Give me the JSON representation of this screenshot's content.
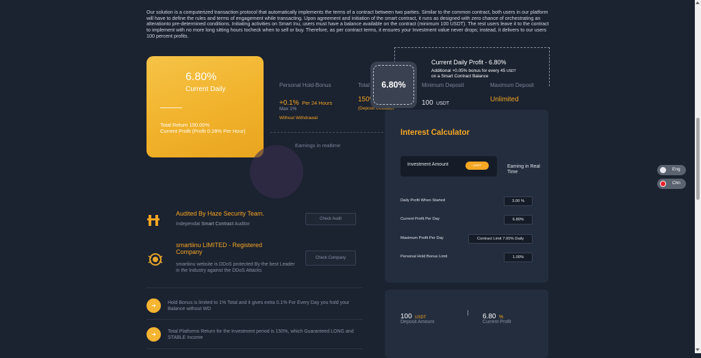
{
  "intro": "Our solution is a computerized transaction protocol that automatically implements the terms of a contract between two parties. Similar to the common contract, both users in our platform will have to define the rules and terms of engagement while transacting. Upon agreement and initiation of the smart contract, it runs as designed with zero chance of orchestrating an alterationto pre-determined conditions. Initiating activities on Smart Inu, users must have a balance available on the contract (minimum 100 USDT). The rest users leave it to the contract to implement with no more long sitting hours tocheck when to sell or buy. Therefore, as per contract terms, it ensures your Investment value never drops; instead, it delivers to our users 100 percent profits.",
  "gold_card": {
    "rate": "6.80%",
    "label": "Current Daily",
    "total_return": "Total Return 150.00%",
    "current_profit": "Current Profit (Profit 0.28% Per Hour)"
  },
  "stats": {
    "hold_label": "Personal Hold-Bonus",
    "hold_value": "+0.1%",
    "hold_unit": "Per 24 Hours",
    "hold_max": "Max 1%",
    "hold_note": "Without Withdrawal",
    "total_label": "Total",
    "total_value": "150%",
    "total_note": "(Deposit Included)",
    "min_label": "Minimum Deposit",
    "min_value": "100",
    "min_unit": "USDT",
    "max_label": "Maximum Deposit",
    "max_value": "Unlimited",
    "earnings": "Earnings in realtime"
  },
  "tooltip": {
    "badge": "6.80%",
    "title": "Current Daily Profit - 6.80%",
    "desc": "Additional +0.05% bonus for every 45",
    "desc_unit": "USDT",
    "desc2": "on a Smart Contract Balance"
  },
  "calculator": {
    "title": "Interest Calculator",
    "investment_label": "Investment Amount",
    "currency": "USDT",
    "earning_label": "Earning in Real Time",
    "rows": [
      {
        "label": "Daily Profit When Started",
        "value": "3.00 %"
      },
      {
        "label": "Current Profit Per Day",
        "value": "6.80%"
      },
      {
        "label": "Maximum Profit Per Day",
        "value": "Contract Limit 7.00% Daily"
      },
      {
        "label": "Personal Hold Bonus Limit",
        "value": "1.00%"
      }
    ]
  },
  "summary": {
    "deposit_value": "100",
    "deposit_unit": "USDT",
    "deposit_label": "Deposit Amount",
    "profit_value": "6.80",
    "profit_unit": "%",
    "profit_label": "Current Profit"
  },
  "audits": [
    {
      "title": "Audited By Haze Security Team.",
      "text_a": "Independat ",
      "text_b": "Smart Contract",
      "text_c": " Auditor",
      "button": "Check Audit"
    },
    {
      "title": "smartiinu LIMITED - Registered Company",
      "text": "smartiinu website is DDoS protected By the best Leader in the Industry against the DDoS Attacks",
      "button": "Check Company"
    }
  ],
  "notes": [
    "Hold Bonus is limited to 1% Total and it gives extra 0.1% For Every Day you hold your Balance without WD",
    "Total Platforms Return for the Investment period is 150%, which Guaranteed LONG and STABLE Income"
  ],
  "languages": [
    "Eng",
    "Chn"
  ],
  "colors": {
    "accent": "#f5a623",
    "background": "#1b2230",
    "panel": "#242d3d"
  }
}
